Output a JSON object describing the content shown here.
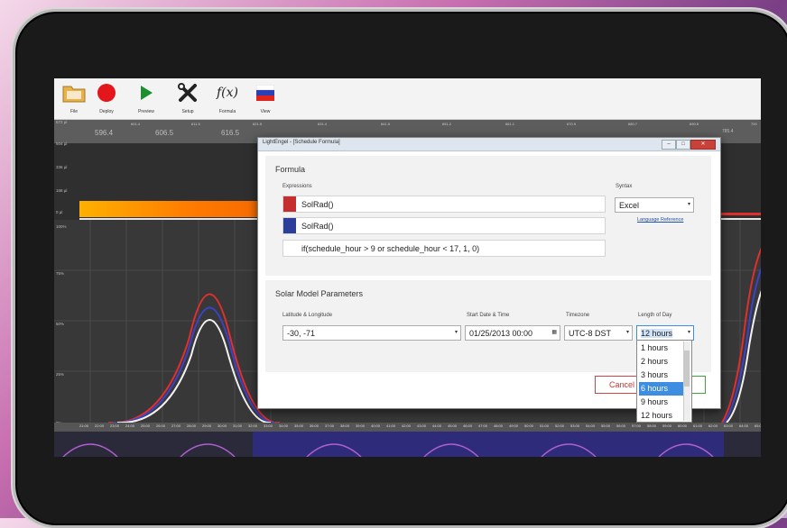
{
  "toolbar": {
    "buttons": [
      {
        "label": "File",
        "icon": "folder-icon"
      },
      {
        "label": "Deploy",
        "icon": "record-icon"
      },
      {
        "label": "Preview",
        "icon": "play-icon"
      },
      {
        "label": "Setup",
        "icon": "tools-icon"
      },
      {
        "label": "Formula",
        "icon": "function-icon"
      },
      {
        "label": "View",
        "icon": "flag-icon"
      }
    ],
    "formula_glyph": "f(x)"
  },
  "ruler": {
    "ticks": [
      "601.4",
      "611.5",
      "621.5",
      "631.4",
      "641.5",
      "651.2",
      "661.1",
      "670.9",
      "680.7",
      "690.5",
      "700"
    ],
    "big_labels": [
      "596.4",
      "606.5",
      "616.5",
      "785.4"
    ]
  },
  "y_axis_upper": [
    "672 µl",
    "504 µl",
    "336 µl",
    "168 µl",
    "0 µl"
  ],
  "y_axis_lower": [
    "100%",
    "75%",
    "50%",
    "25%",
    "0%"
  ],
  "x_axis_labels": [
    "21:00",
    "22:00",
    "23:00",
    "24:00",
    "25:00",
    "26:00",
    "27:00",
    "28:00",
    "29:00",
    "30:00",
    "31:00",
    "32:00",
    "33:00",
    "34:00",
    "35:00",
    "36:00",
    "37:00",
    "38:00",
    "39:00",
    "40:00",
    "41:00",
    "42:00",
    "43:00",
    "44:00",
    "45:00",
    "46:00",
    "47:00",
    "48:00",
    "49:00",
    "50:00",
    "51:00",
    "52:00",
    "53:00",
    "54:00",
    "55:00",
    "56:00",
    "57:00",
    "58:00",
    "59:00",
    "60:00",
    "61:00",
    "62:00",
    "63:00",
    "64:00",
    "65:00"
  ],
  "dialog": {
    "title": "LightEngel - [Schedule Formula]",
    "formula_section": {
      "title": "Formula",
      "expressions_label": "Expressions",
      "syntax_label": "Syntax",
      "syntax_value": "Excel",
      "language_link": "Language Reference",
      "expressions": [
        {
          "text": "SolRad()",
          "color": "#c42e2e"
        },
        {
          "text": "SolRad()",
          "color": "#2c3e9a"
        },
        {
          "text": "if(schedule_hour > 9 or schedule_hour < 17, 1, 0)",
          "color": ""
        }
      ]
    },
    "solar_section": {
      "title": "Solar Model Parameters",
      "latlong_label": "Latitude & Longitude",
      "latlong_value": "-30, -71",
      "start_label": "Start Date & Time",
      "start_value": "01/25/2013 00:00",
      "timezone_label": "Timezone",
      "timezone_value": "UTC-8 DST",
      "length_label": "Length of Day",
      "length_value": "12 hours",
      "length_options": [
        "1 hours",
        "2 hours",
        "3 hours",
        "6 hours",
        "9 hours",
        "12 hours"
      ],
      "length_highlighted": "6 hours"
    },
    "cancel_label": "Cancel"
  },
  "colors": {
    "red_series": "#e0302e",
    "blue_series": "#3a43c9",
    "white_series": "#f2f2f2",
    "accent_select": "#3d8ee0"
  }
}
